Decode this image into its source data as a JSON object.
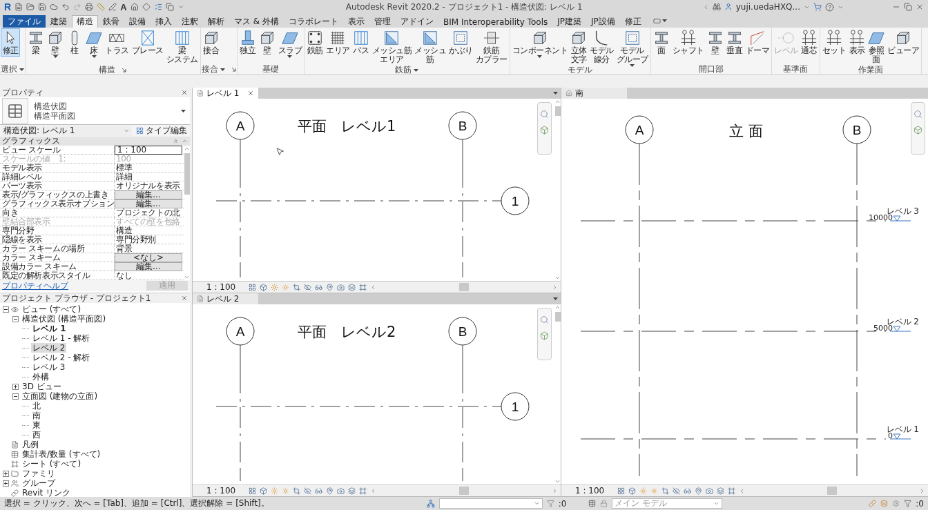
{
  "title_bar": {
    "logo": "R",
    "text_glyph": "A",
    "title": "Autodesk Revit 2020.2 - プロジェクト1 - 構造伏図: レベル 1",
    "user": "yuji.uedaHXQ..."
  },
  "menu_tabs": [
    {
      "label": "ファイル",
      "kind": "file",
      "selected": false
    },
    {
      "label": "建築",
      "kind": "tab",
      "selected": false
    },
    {
      "label": "構造",
      "kind": "tab",
      "selected": true
    },
    {
      "label": "鉄骨",
      "kind": "tab",
      "selected": false
    },
    {
      "label": "設備",
      "kind": "tab",
      "selected": false
    },
    {
      "label": "挿入",
      "kind": "tab",
      "selected": false
    },
    {
      "label": "注釈",
      "kind": "tab",
      "selected": false
    },
    {
      "label": "解析",
      "kind": "tab",
      "selected": false
    },
    {
      "label": "マス & 外構",
      "kind": "tab",
      "selected": false
    },
    {
      "label": "コラボレート",
      "kind": "tab",
      "selected": false
    },
    {
      "label": "表示",
      "kind": "tab",
      "selected": false
    },
    {
      "label": "管理",
      "kind": "tab",
      "selected": false
    },
    {
      "label": "アドイン",
      "kind": "tab",
      "selected": false
    },
    {
      "label": "BIM Interoperability Tools",
      "kind": "tab",
      "selected": false
    },
    {
      "label": "JP建築",
      "kind": "tab",
      "selected": false
    },
    {
      "label": "JP設備",
      "kind": "tab",
      "selected": false
    },
    {
      "label": "修正",
      "kind": "tab",
      "selected": false
    }
  ],
  "ribbon": [
    {
      "label": "選択",
      "menu": true,
      "launcher": false,
      "buttons": [
        {
          "label": "修正",
          "dropdown": false,
          "active": true,
          "disabled": false
        }
      ]
    },
    {
      "label": "構造",
      "menu": false,
      "launcher": true,
      "buttons": [
        {
          "label": "梁",
          "dropdown": false,
          "active": false,
          "disabled": false
        },
        {
          "label": "壁",
          "dropdown": true,
          "active": false,
          "disabled": false
        },
        {
          "label": "柱",
          "dropdown": false,
          "active": false,
          "disabled": false
        },
        {
          "label": "床",
          "dropdown": true,
          "active": false,
          "disabled": false
        },
        {
          "label": "トラス",
          "dropdown": false,
          "active": false,
          "disabled": false
        },
        {
          "label": "ブレース",
          "dropdown": false,
          "active": false,
          "disabled": false
        },
        {
          "label": "梁システム",
          "dropdown": false,
          "active": false,
          "disabled": false
        }
      ]
    },
    {
      "label": "接合",
      "menu": true,
      "launcher": true,
      "buttons": [
        {
          "label": "接合",
          "dropdown": false,
          "active": false,
          "disabled": false
        }
      ]
    },
    {
      "label": "基礎",
      "menu": false,
      "launcher": false,
      "buttons": [
        {
          "label": "独立",
          "dropdown": false,
          "active": false,
          "disabled": false
        },
        {
          "label": "壁",
          "dropdown": false,
          "active": false,
          "disabled": false
        },
        {
          "label": "スラブ",
          "dropdown": true,
          "active": false,
          "disabled": false
        }
      ]
    },
    {
      "label": "鉄筋",
      "menu": true,
      "launcher": false,
      "buttons": [
        {
          "label": "鉄筋",
          "dropdown": false,
          "active": false,
          "disabled": false
        },
        {
          "label": "エリア",
          "dropdown": false,
          "active": false,
          "disabled": false
        },
        {
          "label": "パス",
          "dropdown": false,
          "active": false,
          "disabled": false
        },
        {
          "label": "メッシュ筋エリア",
          "dropdown": false,
          "active": false,
          "disabled": false
        },
        {
          "label": "メッシュ筋",
          "dropdown": false,
          "active": false,
          "disabled": false
        },
        {
          "label": "かぶり",
          "dropdown": false,
          "active": false,
          "disabled": false
        },
        {
          "label": "鉄筋カプラー",
          "dropdown": false,
          "active": false,
          "disabled": false
        }
      ]
    },
    {
      "label": "モデル",
      "menu": false,
      "launcher": false,
      "buttons": [
        {
          "label": "コンポーネント",
          "dropdown": true,
          "active": false,
          "disabled": false
        },
        {
          "label": "立体文字",
          "dropdown": false,
          "active": false,
          "disabled": false
        },
        {
          "label": "モデル線分",
          "dropdown": false,
          "active": false,
          "disabled": false
        },
        {
          "label": "モデルグループ",
          "dropdown": true,
          "active": false,
          "disabled": false
        }
      ]
    },
    {
      "label": "開口部",
      "menu": false,
      "launcher": false,
      "buttons": [
        {
          "label": "面",
          "dropdown": false,
          "active": false,
          "disabled": false
        },
        {
          "label": "シャフト",
          "dropdown": false,
          "active": false,
          "disabled": false
        },
        {
          "label": "壁",
          "dropdown": false,
          "active": false,
          "disabled": false
        },
        {
          "label": "垂直",
          "dropdown": false,
          "active": false,
          "disabled": false
        },
        {
          "label": "ドーマ",
          "dropdown": false,
          "active": false,
          "disabled": false
        }
      ]
    },
    {
      "label": "基準面",
      "menu": false,
      "launcher": false,
      "buttons": [
        {
          "label": "レベル",
          "dropdown": false,
          "active": false,
          "disabled": true
        },
        {
          "label": "通芯",
          "dropdown": false,
          "active": false,
          "disabled": false
        }
      ]
    },
    {
      "label": "作業面",
      "menu": false,
      "launcher": false,
      "buttons": [
        {
          "label": "セット",
          "dropdown": false,
          "active": false,
          "disabled": false
        },
        {
          "label": "表示",
          "dropdown": false,
          "active": false,
          "disabled": false
        },
        {
          "label": "参照面",
          "dropdown": false,
          "active": false,
          "disabled": false
        },
        {
          "label": "ビューア",
          "dropdown": false,
          "active": false,
          "disabled": false
        }
      ]
    }
  ],
  "properties": {
    "title": "プロパティ",
    "type_family": "構造伏図",
    "type_name": "構造平面図",
    "instance": "構造伏図: レベル 1",
    "edit_type": "タイプ編集",
    "group": "グラフィックス",
    "rows": [
      {
        "name": "ビュー スケール",
        "value": "1 : 100",
        "kind": "input",
        "disabled": false
      },
      {
        "name": "スケールの値　1:",
        "value": "100",
        "kind": "text",
        "disabled": true
      },
      {
        "name": "モデル表示",
        "value": "標準",
        "kind": "text",
        "disabled": false
      },
      {
        "name": "詳細レベル",
        "value": "詳細",
        "kind": "text",
        "disabled": false
      },
      {
        "name": "パーツ表示",
        "value": "オリジナルを表示",
        "kind": "text",
        "disabled": false
      },
      {
        "name": "表示/グラフィックスの上書き",
        "value": "編集...",
        "kind": "button",
        "disabled": false
      },
      {
        "name": "グラフィックス表示オプション",
        "value": "編集...",
        "kind": "button",
        "disabled": false
      },
      {
        "name": "向き",
        "value": "プロジェクトの北",
        "kind": "text",
        "disabled": false
      },
      {
        "name": "壁結合部表示",
        "value": "すべての壁を包絡",
        "kind": "text",
        "disabled": true
      },
      {
        "name": "専門分野",
        "value": "構造",
        "kind": "text",
        "disabled": false
      },
      {
        "name": "隠線を表示",
        "value": "専門分野別",
        "kind": "text",
        "disabled": false
      },
      {
        "name": "カラー スキームの場所",
        "value": "背景",
        "kind": "text",
        "disabled": false
      },
      {
        "name": "カラー スキーム",
        "value": "<なし>",
        "kind": "button",
        "disabled": false
      },
      {
        "name": "設備カラー スキーム",
        "value": "編集...",
        "kind": "button",
        "disabled": false
      },
      {
        "name": "既定の解析表示スタイル",
        "value": "なし",
        "kind": "text",
        "disabled": false
      }
    ],
    "help_link": "プロパティヘルプ",
    "apply": {
      "label": "適用",
      "disabled": true
    }
  },
  "browser": {
    "title": "プロジェクト ブラウザ - プロジェクト1",
    "tree": [
      {
        "label": "ビュー (すべて)",
        "expanded": true,
        "selected": false,
        "children": [
          {
            "label": "構造伏図 (構造平面図)",
            "expanded": true,
            "selected": false,
            "children": [
              {
                "label": "レベル 1",
                "current": true,
                "selected": false
              },
              {
                "label": "レベル 1 - 解析",
                "current": false,
                "selected": false
              },
              {
                "label": "レベル 2",
                "current": false,
                "selected": true
              },
              {
                "label": "レベル 2 - 解析",
                "current": false,
                "selected": false
              },
              {
                "label": "レベル 3",
                "current": false,
                "selected": false
              },
              {
                "label": "外構",
                "current": false,
                "selected": false
              }
            ]
          },
          {
            "label": "3D ビュー",
            "expanded": false,
            "selected": false
          },
          {
            "label": "立面図 (建物の立面)",
            "expanded": true,
            "selected": false,
            "children": [
              {
                "label": "北",
                "current": false,
                "selected": false
              },
              {
                "label": "南",
                "current": false,
                "selected": false
              },
              {
                "label": "東",
                "current": false,
                "selected": false
              },
              {
                "label": "西",
                "current": false,
                "selected": false
              }
            ]
          }
        ]
      },
      {
        "label": "凡例",
        "selected": false
      },
      {
        "label": "集計表/数量 (すべて)",
        "selected": false
      },
      {
        "label": "シート (すべて)",
        "selected": false
      },
      {
        "label": "ファミリ",
        "expanded": false,
        "selected": false
      },
      {
        "label": "グループ",
        "expanded": false,
        "selected": false
      },
      {
        "label": "Revit リンク",
        "selected": false
      }
    ]
  },
  "views": [
    {
      "tab": "レベル 1",
      "kind": "plan",
      "active": true,
      "heading": "平面　レベル1",
      "grids_vertical": [
        "A",
        "B"
      ],
      "grids_horizontal": [
        "1"
      ],
      "scale": "1 : 100"
    },
    {
      "tab": "レベル 2",
      "kind": "plan",
      "active": false,
      "heading": "平面　レベル2",
      "grids_vertical": [
        "A",
        "B"
      ],
      "grids_horizontal": [
        "1"
      ],
      "scale": "1 : 100"
    },
    {
      "tab": "南",
      "kind": "elevation",
      "active": false,
      "heading": "立 面",
      "grids_vertical": [
        "A",
        "B"
      ],
      "levels": [
        {
          "name": "レベル 3",
          "elevation": "10000"
        },
        {
          "name": "レベル 2",
          "elevation": "5000"
        },
        {
          "name": "レベル 1",
          "elevation": "0"
        }
      ],
      "scale": "1 : 100"
    }
  ],
  "status_bar": {
    "hint": "選択 = クリック、次へ = [Tab]、追加 = [Ctrl]、選択解除 = [Shift]。",
    "filter_count": ":0",
    "model": "メイン モデル",
    "select_count": ":0"
  }
}
